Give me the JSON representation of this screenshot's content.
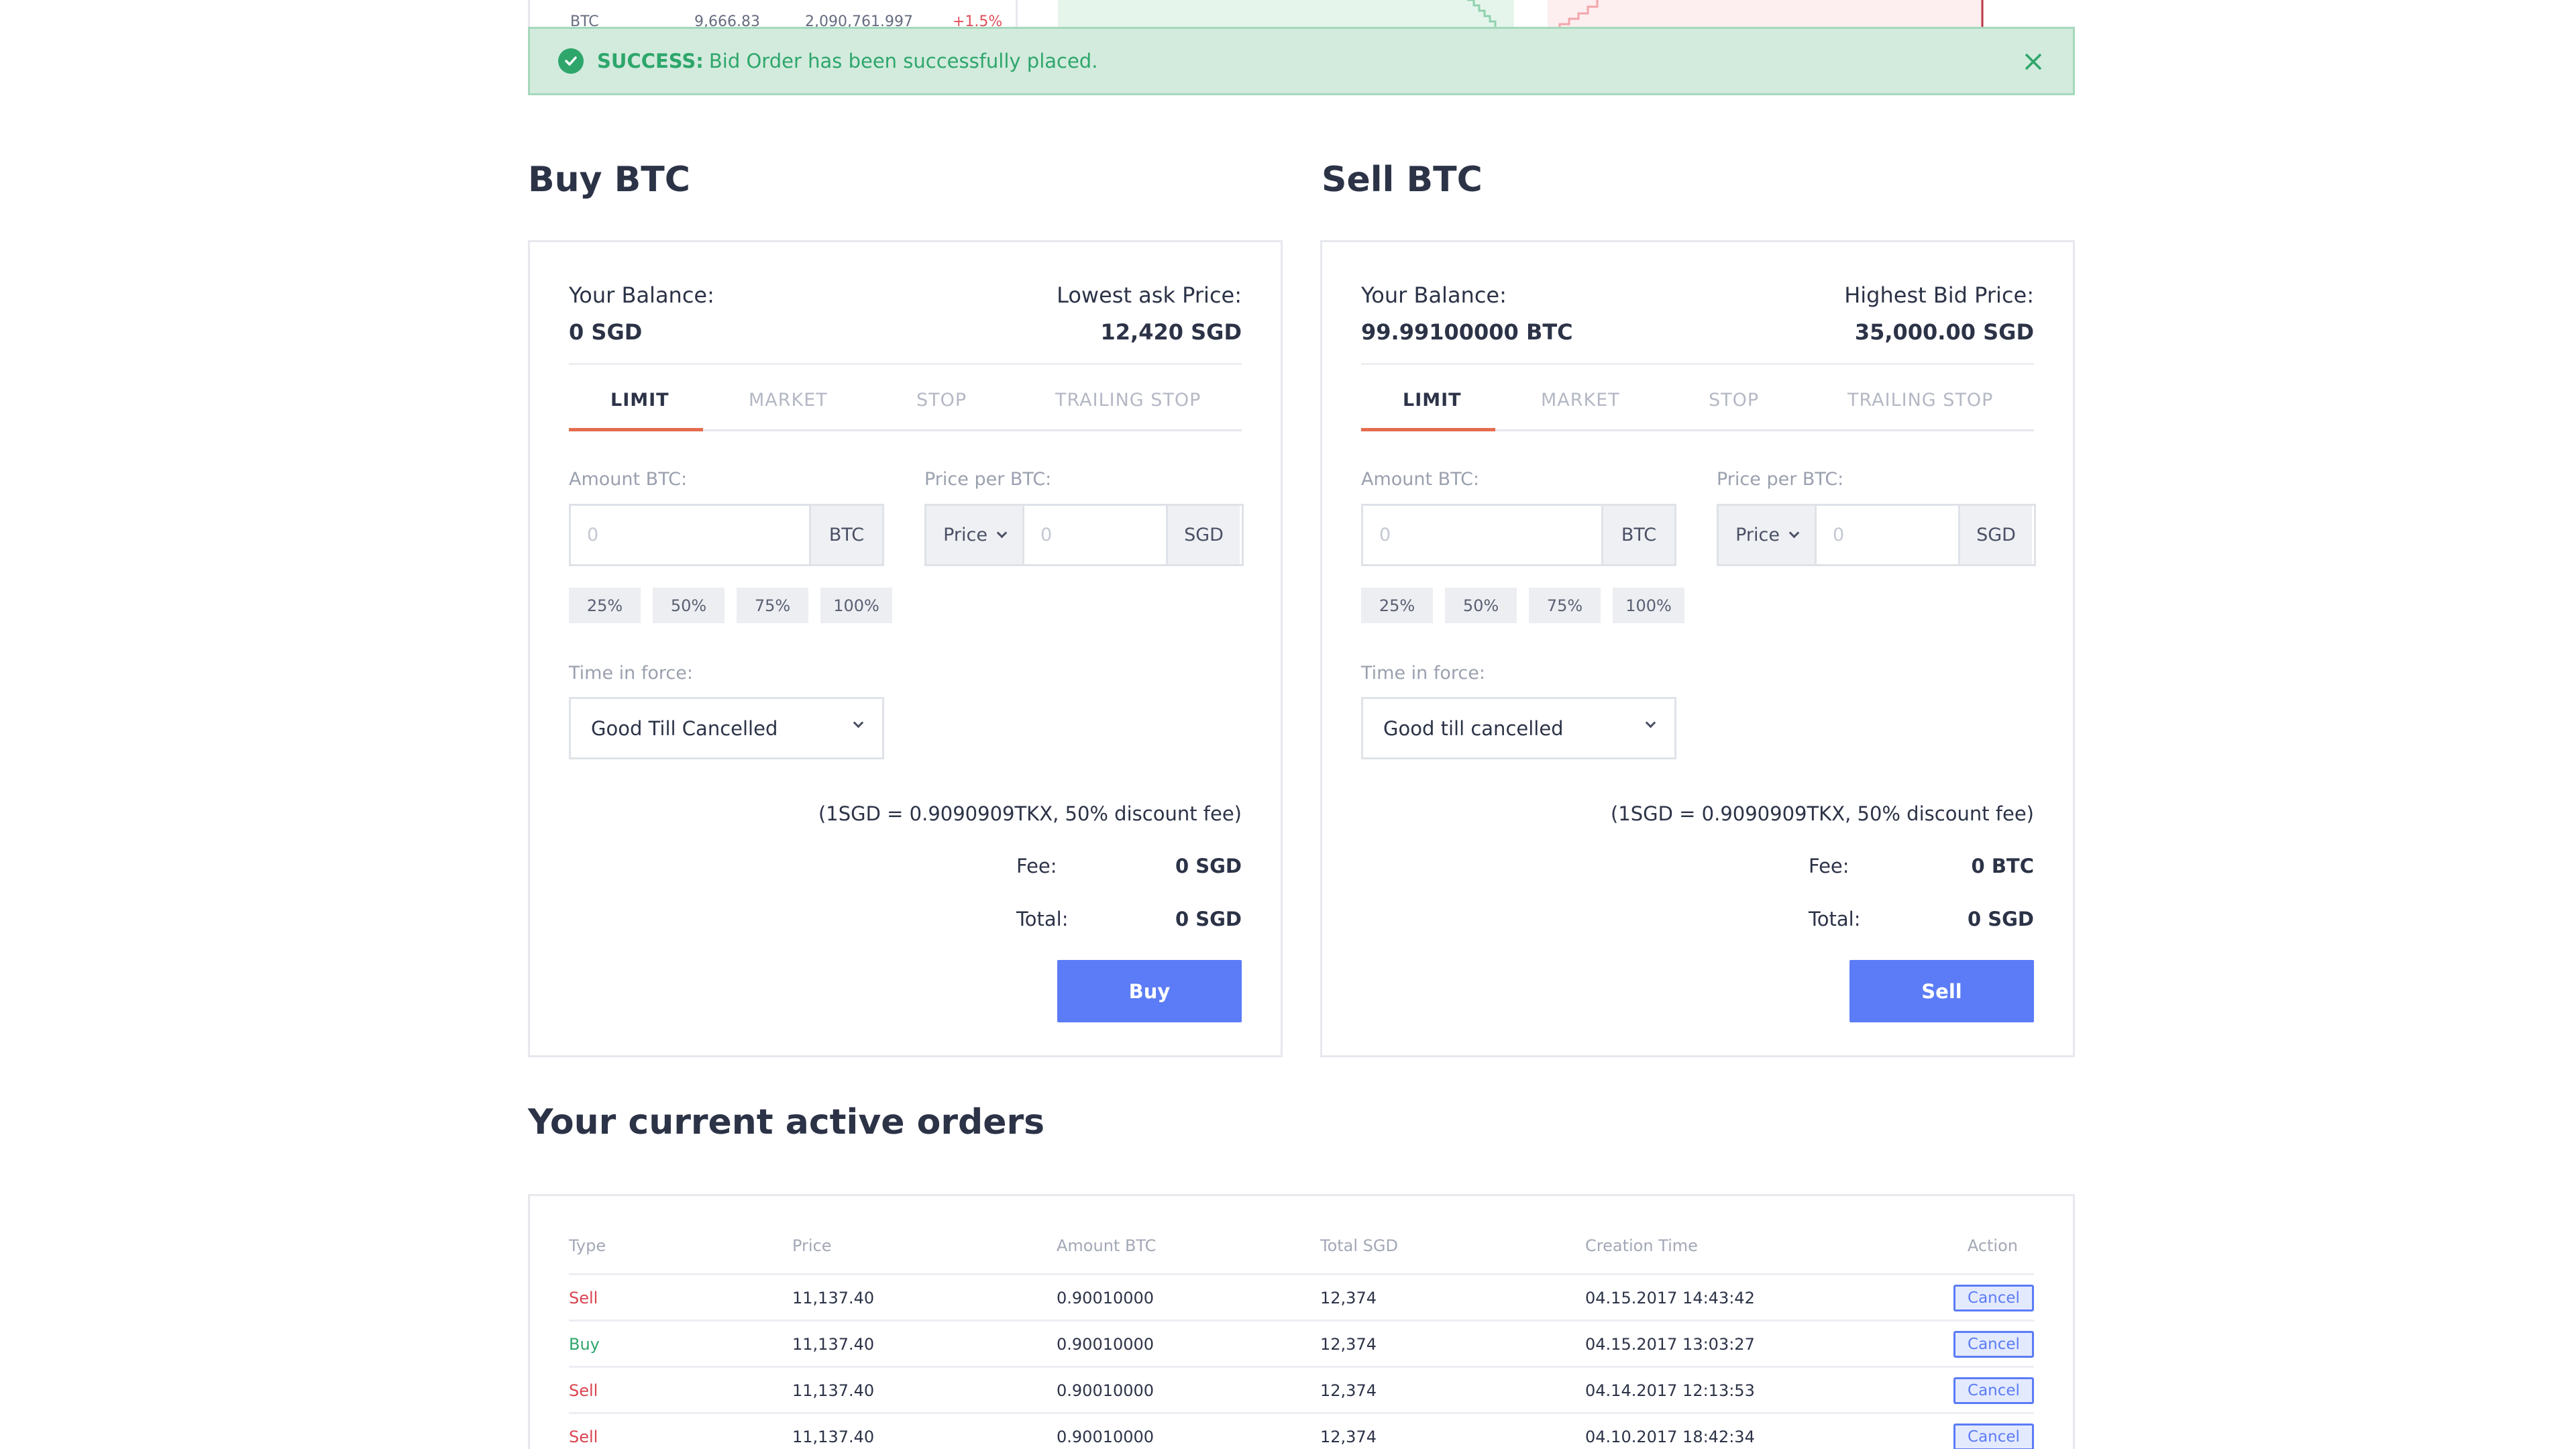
{
  "top_strip": {
    "market_row": {
      "coin": "BTC",
      "price": "9,666.83",
      "volume": "2,090,761.997",
      "change": "+1.5%"
    }
  },
  "banner": {
    "title": "SUCCESS:",
    "message": "Bid Order has been successfully placed.",
    "color": "#2ea66b"
  },
  "buy": {
    "heading": "Buy BTC",
    "balance_label": "Your Balance:",
    "balance_value": "0 SGD",
    "price_label": "Lowest ask Price:",
    "price_value": "12,420 SGD",
    "tabs": [
      "LIMIT",
      "MARKET",
      "STOP",
      "TRAILING STOP"
    ],
    "active_tab": "LIMIT",
    "amount_label": "Amount BTC:",
    "amount_placeholder": "0",
    "amount_unit": "BTC",
    "price_per_label": "Price per BTC:",
    "price_type": "Price",
    "price_placeholder": "0",
    "price_unit": "SGD",
    "pcts": [
      "25%",
      "50%",
      "75%",
      "100%"
    ],
    "tif_label": "Time in force:",
    "tif_value": "Good Till Cancelled",
    "rate_note": "(1SGD = 0.9090909TKX, 50% discount fee)",
    "fee_label": "Fee:",
    "fee_value": "0 SGD",
    "total_label": "Total:",
    "total_value": "0 SGD",
    "button": "Buy"
  },
  "sell": {
    "heading": "Sell BTC",
    "balance_label": "Your Balance:",
    "balance_value": "99.99100000 BTC",
    "price_label": "Highest Bid Price:",
    "price_value": "35,000.00 SGD",
    "tabs": [
      "LIMIT",
      "MARKET",
      "STOP",
      "TRAILING STOP"
    ],
    "active_tab": "LIMIT",
    "amount_label": "Amount BTC:",
    "amount_placeholder": "0",
    "amount_unit": "BTC",
    "price_per_label": "Price per BTC:",
    "price_type": "Price",
    "price_placeholder": "0",
    "price_unit": "SGD",
    "pcts": [
      "25%",
      "50%",
      "75%",
      "100%"
    ],
    "tif_label": "Time in force:",
    "tif_value": "Good till cancelled",
    "rate_note": "(1SGD = 0.9090909TKX, 50% discount fee)",
    "fee_label": "Fee:",
    "fee_value": "0 BTC",
    "total_label": "Total:",
    "total_value": "0 SGD",
    "button": "Sell"
  },
  "orders": {
    "heading": "Your current active orders",
    "columns": [
      "Type",
      "Price",
      "Amount BTC",
      "Total SGD",
      "Creation Time",
      "Action"
    ],
    "rows": [
      {
        "type": "Sell",
        "price": "11,137.40",
        "amount": "0.90010000",
        "total": "12,374",
        "time": "04.15.2017 14:43:42",
        "action": "Cancel"
      },
      {
        "type": "Buy",
        "price": "11,137.40",
        "amount": "0.90010000",
        "total": "12,374",
        "time": "04.15.2017 13:03:27",
        "action": "Cancel"
      },
      {
        "type": "Sell",
        "price": "11,137.40",
        "amount": "0.90010000",
        "total": "12,374",
        "time": "04.14.2017 12:13:53",
        "action": "Cancel"
      },
      {
        "type": "Sell",
        "price": "11,137.40",
        "amount": "0.90010000",
        "total": "12,374",
        "time": "04.10.2017 18:42:34",
        "action": "Cancel"
      }
    ]
  },
  "colors": {
    "accent": "#5b7cf6",
    "tab_underline": "#e56b4c",
    "sell": "#d9444f",
    "buy": "#2ea66b"
  },
  "icons": {
    "banner_status": "check-circle-icon",
    "banner_close": "close-icon",
    "dropdown": "chevron-down-icon"
  }
}
